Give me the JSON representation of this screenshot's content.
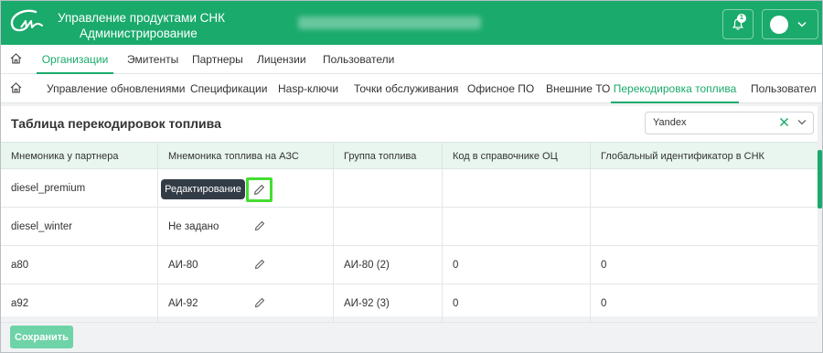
{
  "header": {
    "title_line1": "Управление продуктами СНК",
    "title_line2": "Администрирование",
    "notification_count": "1",
    "brand_color": "#1aaa6c"
  },
  "nav_primary": [
    {
      "label": "Организации",
      "active": true
    },
    {
      "label": "Эмитенты",
      "active": false
    },
    {
      "label": "Партнеры",
      "active": false
    },
    {
      "label": "Лицензии",
      "active": false
    },
    {
      "label": "Пользователи",
      "active": false
    }
  ],
  "nav_secondary": [
    {
      "label": "Управление обновлениями",
      "active": false
    },
    {
      "label": "Спецификации",
      "active": false
    },
    {
      "label": "Hasp-ключи",
      "active": false
    },
    {
      "label": "Точки обслуживания",
      "active": false
    },
    {
      "label": "Офисное ПО",
      "active": false
    },
    {
      "label": "Внешние ТО",
      "active": false
    },
    {
      "label": "Перекодировка топлива",
      "active": true
    },
    {
      "label": "Пользовател",
      "active": false
    }
  ],
  "card": {
    "title": "Таблица перекодировок топлива",
    "partner_select": {
      "value": "Yandex"
    }
  },
  "table": {
    "columns": [
      "Мнемоника у партнера",
      "Мнемоника топлива на АЗС",
      "Группа топлива",
      "Код в справочнике ОЦ",
      "Глобальный идентификатор в СНК"
    ],
    "rows": [
      {
        "partner": "diesel_premium",
        "azs": "",
        "group": "",
        "code": "",
        "global_id": ""
      },
      {
        "partner": "diesel_winter",
        "azs": "Не задано",
        "group": "",
        "code": "",
        "global_id": ""
      },
      {
        "partner": "a80",
        "azs": "АИ-80",
        "group": "АИ-80 (2)",
        "code": "0",
        "global_id": "0"
      },
      {
        "partner": "a92",
        "azs": "АИ-92",
        "group": "АИ-92 (3)",
        "code": "0",
        "global_id": "0"
      }
    ]
  },
  "tooltip": {
    "text": "Редактирование"
  },
  "footer": {
    "save_label": "Сохранить"
  }
}
